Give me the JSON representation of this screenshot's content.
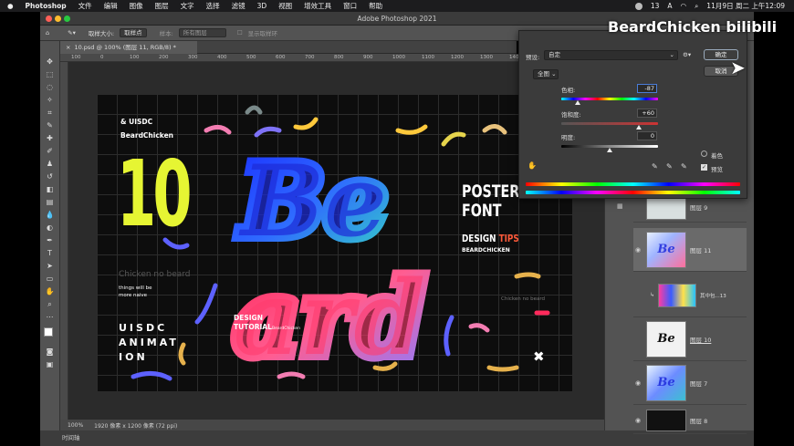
{
  "menubar": {
    "apple": "",
    "app": "Photoshop",
    "items": [
      "文件",
      "编辑",
      "图像",
      "图层",
      "文字",
      "选择",
      "滤镜",
      "3D",
      "视图",
      "增效工具",
      "窗口",
      "帮助"
    ],
    "status_count": "13",
    "status_letter": "A",
    "clock": "11月9日 周二 上午12:09"
  },
  "window": {
    "title": "Adobe Photoshop 2021"
  },
  "options": {
    "sample_size_label": "取样大小:",
    "sample_size_value": "取样点",
    "sample_label": "样本:",
    "sample_value": "所有图层",
    "show_ring": "显示取样环"
  },
  "document": {
    "tab": "10.psd @ 100% (图层 11, RGB/8) *",
    "zoom": "100%",
    "size_info": "1920 像素 x 1200 像素 (72 ppi)",
    "ruler_ticks": [
      "100",
      "0",
      "100",
      "200",
      "300",
      "400",
      "500",
      "600",
      "700",
      "800",
      "900",
      "1000",
      "1100",
      "1200",
      "1300",
      "1400",
      "1500",
      "1600"
    ]
  },
  "timeline": {
    "label": "时间轴"
  },
  "artwork": {
    "uisdc": "& UISDC",
    "author": "BeardChicken",
    "big_number": "10",
    "be": "Be",
    "ard": "ard",
    "poster": "POSTER",
    "font": "FONT",
    "design": "DESIGN",
    "tips": "TIPS",
    "beardchicken_caps": "BEARDCHICKEN",
    "chicken_no_beard": "Chicken no beard",
    "things1": "things will be",
    "things2": "more naive",
    "chicken_small": "Chicken no beard",
    "design2": "DESIGN",
    "tutorial": "TUTORIAL",
    "beardchicken_small": "BeardChicken",
    "anim1": "UISDC",
    "anim2": "ANIMAT",
    "anim3": "ION",
    "cross": "✖"
  },
  "dialog": {
    "preset_label": "预设:",
    "preset_value": "自定",
    "channel_value": "全图",
    "hue_label": "色相:",
    "hue_value": "-87",
    "saturation_label": "饱和度:",
    "saturation_value": "+60",
    "lightness_label": "明度:",
    "lightness_value": "0",
    "ok": "确定",
    "cancel": "取消",
    "colorize": "着色",
    "preview": "预览",
    "hue_level": 0.17,
    "saturation_level": 0.8,
    "lightness_level": 0.5
  },
  "layers": [
    {
      "name": "图层 9"
    },
    {
      "name": "图层 11"
    },
    {
      "name": "其中包...13"
    },
    {
      "name": "图层 10"
    },
    {
      "name": "图层 7"
    },
    {
      "name": "图层 8"
    }
  ],
  "watermark": "BeardChicken bilibili"
}
